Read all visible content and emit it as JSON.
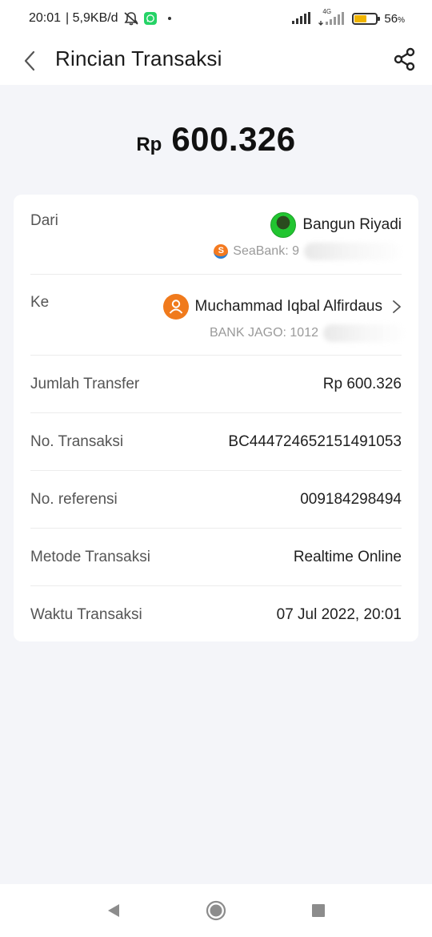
{
  "status_bar": {
    "time": "20:01",
    "network_speed": "| 5,9KB/d",
    "network_label": "4G",
    "battery_percent": "56",
    "battery_unit": "%",
    "battery_level": 0.56,
    "icons": [
      "alarm-off-icon",
      "whatsapp-icon",
      "signal-icon",
      "battery-icon"
    ]
  },
  "header": {
    "title": "Rincian Transaksi",
    "back_icon": "chevron-left-icon",
    "share_icon": "share-icon"
  },
  "amount": {
    "currency": "Rp",
    "value": "600.326"
  },
  "details": {
    "from": {
      "label": "Dari",
      "name": "Bangun Riyadi",
      "bank_prefix": "SeaBank: 9"
    },
    "to": {
      "label": "Ke",
      "name": "Muchammad Iqbal Alfirdaus",
      "bank_prefix": "BANK JAGO: 1012"
    },
    "rows": [
      {
        "label": "Jumlah Transfer",
        "value": "Rp 600.326"
      },
      {
        "label": "No. Transaksi",
        "value": "BC444724652151491053"
      },
      {
        "label": "No. referensi",
        "value": "009184298494"
      },
      {
        "label": "Metode Transaksi",
        "value": "Realtime Online"
      },
      {
        "label": "Waktu Transaksi",
        "value": "07 Jul 2022, 20:01"
      }
    ]
  },
  "colors": {
    "background": "#f4f5f9",
    "card": "#ffffff",
    "avatar_orange": "#f07a1c",
    "seabank_orange": "#f47a20",
    "whatsapp_green": "#25d366",
    "battery_yellow": "#f0b400"
  }
}
